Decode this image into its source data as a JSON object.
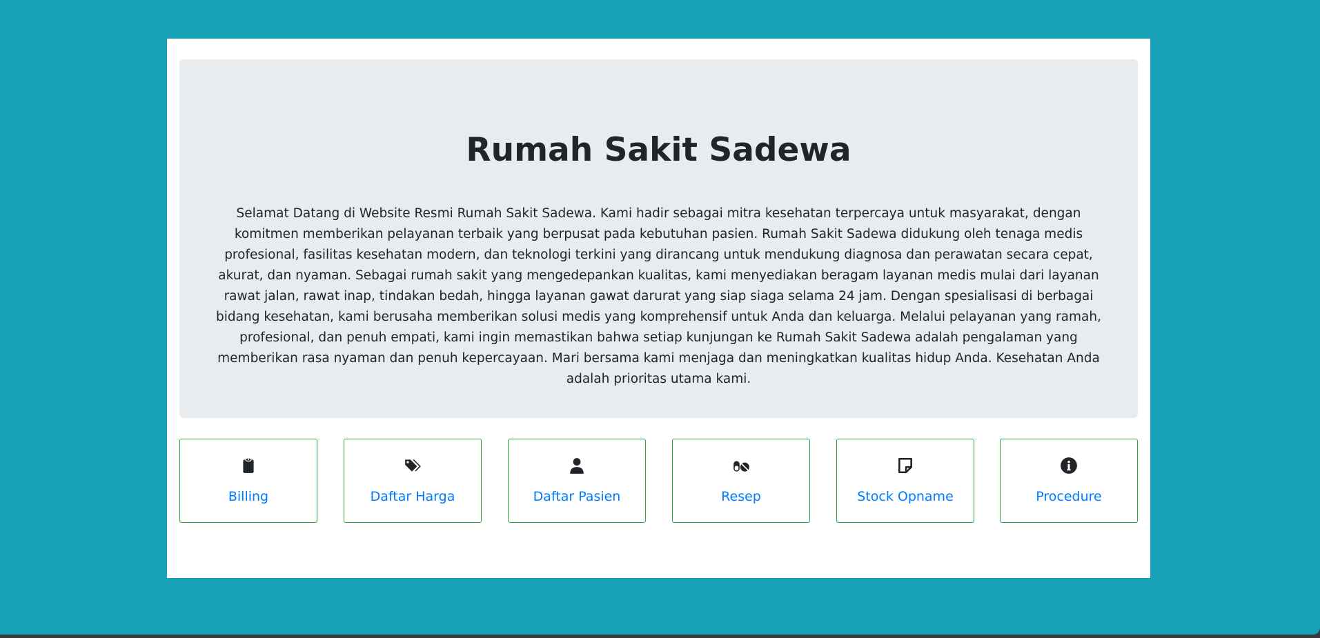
{
  "hero": {
    "title": "Rumah Sakit Sadewa",
    "description": "Selamat Datang di Website Resmi Rumah Sakit Sadewa. Kami hadir sebagai mitra kesehatan terpercaya untuk masyarakat, dengan komitmen memberikan pelayanan terbaik yang berpusat pada kebutuhan pasien. Rumah Sakit Sadewa didukung oleh tenaga medis profesional, fasilitas kesehatan modern, dan teknologi terkini yang dirancang untuk mendukung diagnosa dan perawatan secara cepat, akurat, dan nyaman. Sebagai rumah sakit yang mengedepankan kualitas, kami menyediakan beragam layanan medis mulai dari layanan rawat jalan, rawat inap, tindakan bedah, hingga layanan gawat darurat yang siap siaga selama 24 jam. Dengan spesialisasi di berbagai bidang kesehatan, kami berusaha memberikan solusi medis yang komprehensif untuk Anda dan keluarga. Melalui pelayanan yang ramah, profesional, dan penuh empati, kami ingin memastikan bahwa setiap kunjungan ke Rumah Sakit Sadewa adalah pengalaman yang memberikan rasa nyaman dan penuh kepercayaan. Mari bersama kami menjaga dan meningkatkan kualitas hidup Anda. Kesehatan Anda adalah prioritas utama kami."
  },
  "menu": [
    {
      "label": "Billing",
      "icon": "clipboard-icon"
    },
    {
      "label": "Daftar Harga",
      "icon": "tags-icon"
    },
    {
      "label": "Daftar Pasien",
      "icon": "user-icon"
    },
    {
      "label": "Resep",
      "icon": "pills-icon"
    },
    {
      "label": "Stock Opname",
      "icon": "sticky-note-icon"
    },
    {
      "label": "Procedure",
      "icon": "info-circle-icon"
    }
  ],
  "colors": {
    "background": "#17a2b8",
    "card_border": "#28a745",
    "link": "#007bff",
    "jumbotron": "#e9ecef"
  }
}
